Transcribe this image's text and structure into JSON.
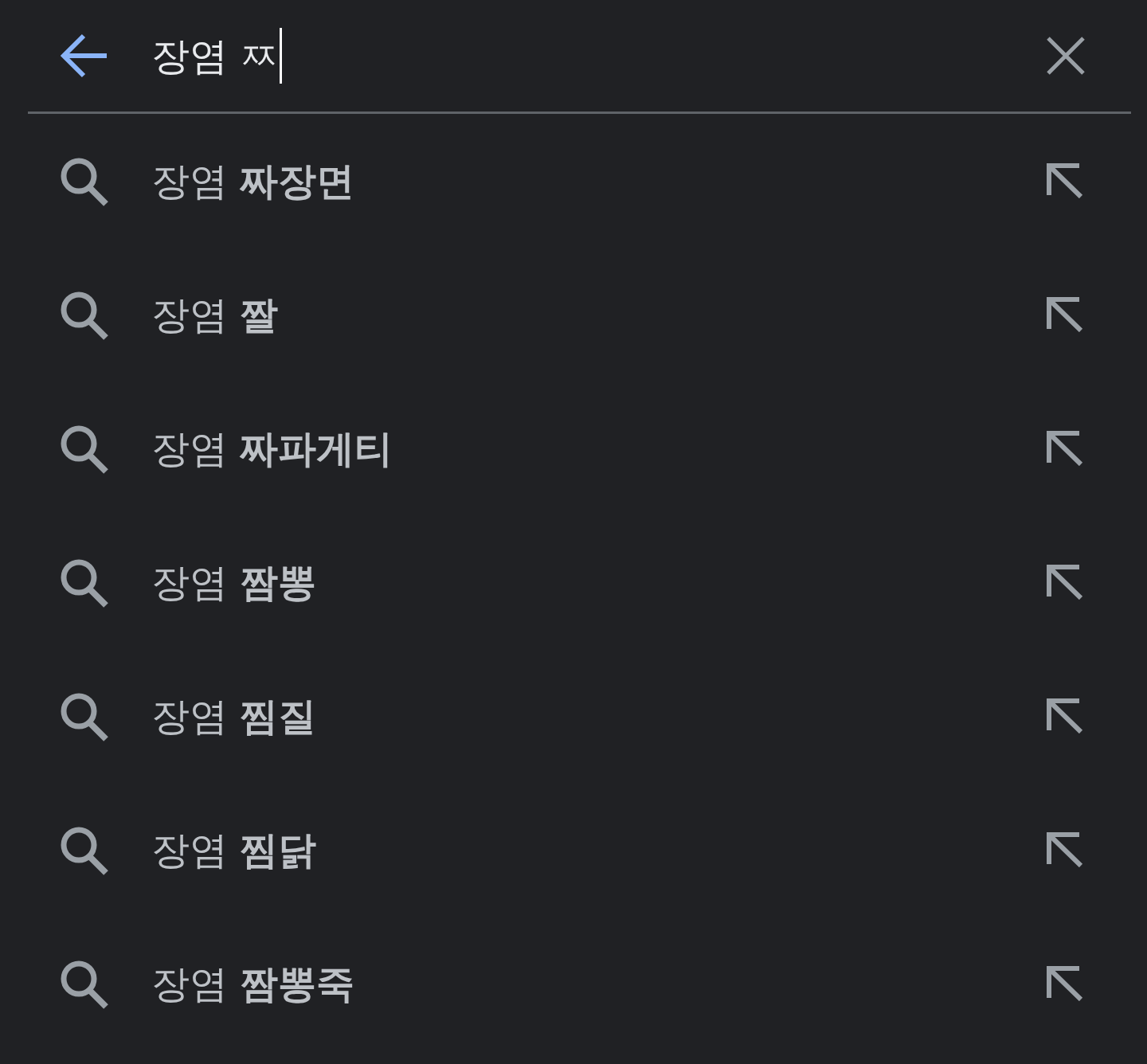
{
  "search_bar": {
    "value": "장염 ㅉ",
    "focused": true
  },
  "suggestions": [
    {
      "text": "장염 **짜장면**"
    },
    {
      "text": "장염 **짤**"
    },
    {
      "text": "장염 **짜파게티**"
    },
    {
      "text": "장염 **짬뽕**"
    },
    {
      "text": "장염 **찜질**"
    },
    {
      "text": "장염 **찜닭**"
    },
    {
      "text": "장염 **짬뽕죽**"
    }
  ]
}
